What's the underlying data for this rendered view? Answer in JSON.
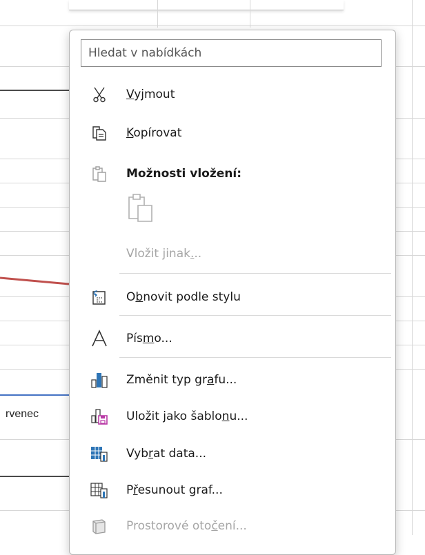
{
  "background": {
    "cell_text": "rvenec"
  },
  "menu": {
    "search_placeholder": "Hledat v nabídkách",
    "items": [
      {
        "pre": "",
        "u": "V",
        "post": "yjmout",
        "icon": "scissors-icon",
        "enabled": true
      },
      {
        "pre": "",
        "u": "K",
        "post": "opírovat",
        "icon": "copy-icon",
        "enabled": true
      },
      {
        "label": "Možnosti vložení:",
        "icon": "paste-icon",
        "enabled": true
      },
      {
        "pre": "Vložit jinak",
        "u": ".",
        "post": "..",
        "enabled": false
      },
      {
        "pre": "O",
        "u": "b",
        "post": "novit podle stylu",
        "icon": "reset-style-icon",
        "enabled": true
      },
      {
        "pre": "Pís",
        "u": "m",
        "post": "o...",
        "icon": "font-icon",
        "enabled": true
      },
      {
        "pre": "Změnit typ gr",
        "u": "a",
        "post": "fu...",
        "icon": "chart-type-icon",
        "enabled": true
      },
      {
        "pre": "Uložit jako šablo",
        "u": "n",
        "post": "u...",
        "icon": "save-template-icon",
        "enabled": true
      },
      {
        "pre": "Vyb",
        "u": "r",
        "post": "at data...",
        "icon": "select-data-icon",
        "enabled": true
      },
      {
        "pre": "P",
        "u": "ř",
        "post": "esunout graf...",
        "icon": "move-chart-icon",
        "enabled": true
      },
      {
        "pre": "Prostorové oto",
        "u": "č",
        "post": "ení...",
        "icon": "rotation-3d-icon",
        "enabled": false
      }
    ]
  },
  "colors": {
    "accent_blue": "#4472c4",
    "chart_red": "#c0504d",
    "disabled_text": "#a6a6a6"
  }
}
